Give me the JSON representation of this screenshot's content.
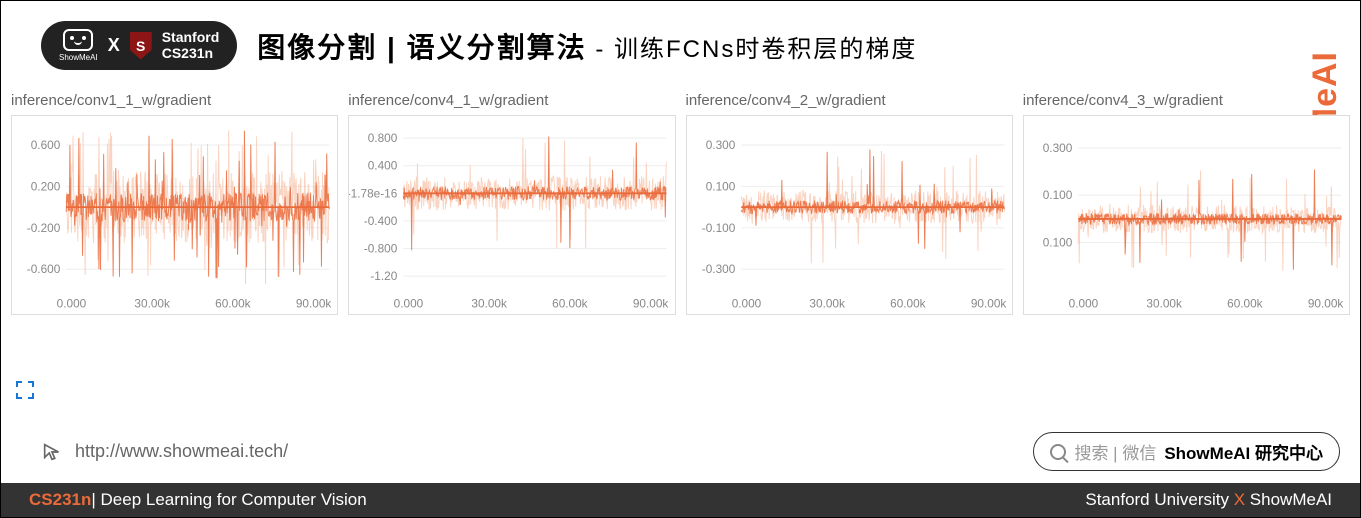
{
  "badge": {
    "showme_label": "ShowMeAI",
    "x": "X",
    "stanford_top": "Stanford",
    "stanford_bottom": "CS231n",
    "shield": "S"
  },
  "title_main": "图像分割  |  语义分割算法",
  "title_sub": " - 训练FCNs时卷积层的梯度",
  "vertical_brand": "ShowMeAI",
  "url": "http://www.showmeai.tech/",
  "search": {
    "hint": "搜索 | 微信",
    "bold": "ShowMeAI 研究中心"
  },
  "footer": {
    "course": "CS231n",
    "course_sub": "| Deep Learning for Computer Vision",
    "right_a": "Stanford  University",
    "right_x": " X ",
    "right_b": "ShowMeAI"
  },
  "chart_data": [
    {
      "type": "line",
      "title": "inference/conv1_1_w/gradient",
      "x_ticks": [
        "0.000",
        "30.00k",
        "60.00k",
        "90.00k"
      ],
      "y_ticks": [
        "-0.600",
        "-0.200",
        "0.200",
        "0.600"
      ],
      "x_range": [
        0,
        100000
      ],
      "y_range": [
        -0.8,
        0.8
      ],
      "center": 0,
      "noise_amp": 0.35,
      "spike_amp": 0.75,
      "spike_density": 0.1
    },
    {
      "type": "line",
      "title": "inference/conv4_1_w/gradient",
      "x_ticks": [
        "0.000",
        "30.00k",
        "60.00k",
        "90.00k"
      ],
      "y_ticks": [
        "-1.20",
        "-0.800",
        "-0.400",
        "-1.78e-16",
        "0.400",
        "0.800"
      ],
      "x_range": [
        0,
        100000
      ],
      "y_range": [
        -1.4,
        1.0
      ],
      "center": -1.78e-16,
      "noise_amp": 0.25,
      "spike_amp": 0.85,
      "spike_density": 0.04
    },
    {
      "type": "line",
      "title": "inference/conv4_2_w/gradient",
      "x_ticks": [
        "0.000",
        "30.00k",
        "60.00k",
        "90.00k"
      ],
      "y_ticks": [
        "-0.300",
        "-0.100",
        "0.100",
        "0.300"
      ],
      "x_range": [
        0,
        100000
      ],
      "y_range": [
        -0.4,
        0.4
      ],
      "center": 0,
      "noise_amp": 0.08,
      "spike_amp": 0.28,
      "spike_density": 0.04
    },
    {
      "type": "line",
      "title": "inference/conv4_3_w/gradient",
      "x_ticks": [
        "0.000",
        "30.00k",
        "60.00k",
        "90.00k"
      ],
      "y_ticks": [
        "0.100",
        "0.100",
        "0.300"
      ],
      "y_tick_vals": [
        -0.1,
        0.1,
        0.3
      ],
      "x_range": [
        0,
        100000
      ],
      "y_range": [
        -0.3,
        0.4
      ],
      "center": 0,
      "noise_amp": 0.06,
      "spike_amp": 0.22,
      "spike_density": 0.04
    }
  ]
}
